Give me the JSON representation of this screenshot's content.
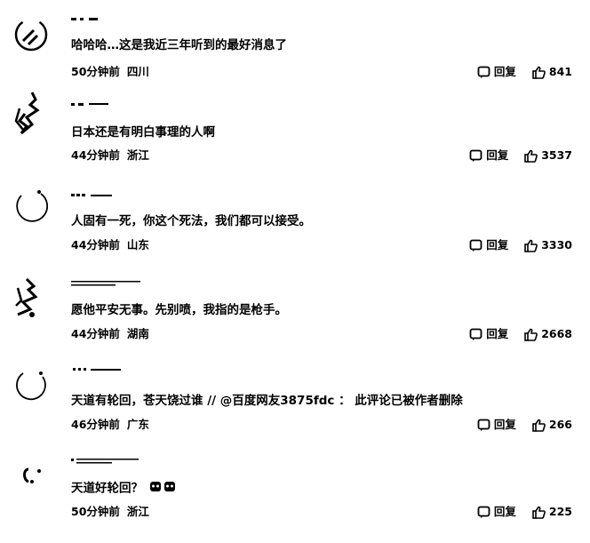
{
  "comments": [
    {
      "content": "哈哈哈…这是我近三年听到的最好消息了",
      "time": "50分钟前",
      "location": "四川",
      "reply_label": "回复",
      "likes": "841",
      "avatar_icon": "user-avatar-icon"
    },
    {
      "content": "日本还是有明白事理的人啊",
      "time": "44分钟前",
      "location": "浙江",
      "reply_label": "回复",
      "likes": "3537",
      "avatar_icon": "user-avatar-icon"
    },
    {
      "content": "人固有一死，你这个死法，我们都可以接受。",
      "time": "44分钟前",
      "location": "山东",
      "reply_label": "回复",
      "likes": "3330",
      "avatar_icon": "user-avatar-icon"
    },
    {
      "content": "愿他平安无事。先别喷，我指的是枪手。",
      "time": "44分钟前",
      "location": "湖南",
      "reply_label": "回复",
      "likes": "2668",
      "avatar_icon": "user-avatar-icon"
    },
    {
      "content": "天道有轮回，苍天饶过谁 // @百度网友3875fdc ： 此评论已被作者删除",
      "time": "46分钟前",
      "location": "广东",
      "reply_label": "回复",
      "likes": "266",
      "avatar_icon": "user-avatar-icon"
    },
    {
      "content": "天道好轮回？",
      "time": "50分钟前",
      "location": "浙江",
      "reply_label": "回复",
      "likes": "225",
      "avatar_icon": "user-avatar-icon",
      "emoji_icons": [
        "emoji-face-icon",
        "emoji-face-icon"
      ]
    }
  ],
  "icons": {
    "reply": "comment-bubble-icon",
    "like": "thumbs-up-icon"
  }
}
